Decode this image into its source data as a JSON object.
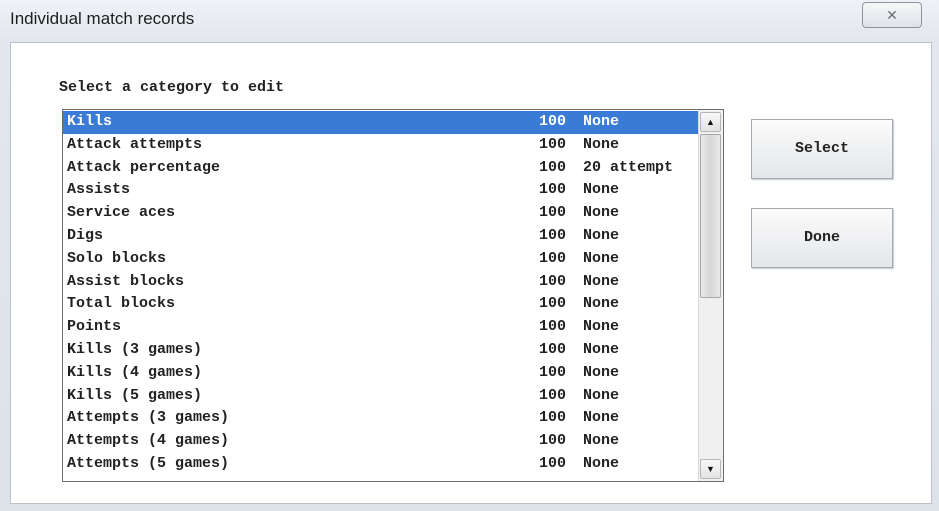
{
  "window": {
    "title": "Individual match records",
    "close_glyph": "✕"
  },
  "dialog": {
    "prompt": "Select a category to edit",
    "select_label": "Select",
    "done_label": "Done",
    "selected_index": 0,
    "colors": {
      "selection": "#3a7bd5"
    },
    "scroll_up_icon": "scroll-up-arrow-icon",
    "scroll_down_icon": "scroll-down-arrow-icon",
    "categories": [
      {
        "name": "Kills",
        "count": "100",
        "minimum": "None"
      },
      {
        "name": "Attack attempts",
        "count": "100",
        "minimum": "None"
      },
      {
        "name": "Attack percentage",
        "count": "100",
        "minimum": "20 attempt"
      },
      {
        "name": "Assists",
        "count": "100",
        "minimum": "None"
      },
      {
        "name": "Service aces",
        "count": "100",
        "minimum": "None"
      },
      {
        "name": "Digs",
        "count": "100",
        "minimum": "None"
      },
      {
        "name": "Solo blocks",
        "count": "100",
        "minimum": "None"
      },
      {
        "name": "Assist blocks",
        "count": "100",
        "minimum": "None"
      },
      {
        "name": "Total blocks",
        "count": "100",
        "minimum": "None"
      },
      {
        "name": "Points",
        "count": "100",
        "minimum": "None"
      },
      {
        "name": "Kills (3 games)",
        "count": "100",
        "minimum": "None"
      },
      {
        "name": "Kills (4 games)",
        "count": "100",
        "minimum": "None"
      },
      {
        "name": "Kills (5 games)",
        "count": "100",
        "minimum": "None"
      },
      {
        "name": "Attempts (3 games)",
        "count": "100",
        "minimum": "None"
      },
      {
        "name": "Attempts (4 games)",
        "count": "100",
        "minimum": "None"
      },
      {
        "name": "Attempts (5 games)",
        "count": "100",
        "minimum": "None"
      }
    ]
  }
}
